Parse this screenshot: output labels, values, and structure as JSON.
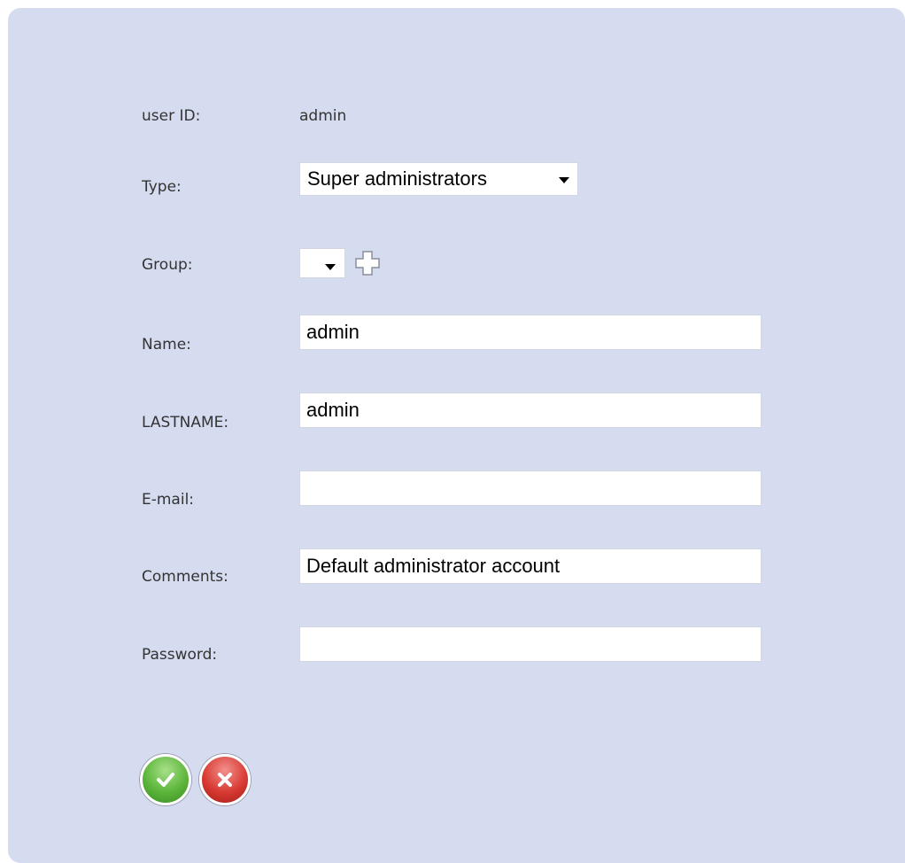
{
  "form": {
    "user_id": {
      "label": "user ID:",
      "value": "admin"
    },
    "type": {
      "label": "Type:",
      "selected": "Super administrators"
    },
    "group": {
      "label": "Group:",
      "selected": ""
    },
    "name": {
      "label": "Name:",
      "value": "admin"
    },
    "lastname": {
      "label": "LASTNAME:",
      "value": "admin"
    },
    "email": {
      "label": "E-mail:",
      "value": ""
    },
    "comments": {
      "label": "Comments:",
      "value": "Default administrator account"
    },
    "password": {
      "label": "Password:",
      "value": ""
    }
  },
  "icons": {
    "add_group": "plus-icon",
    "confirm": "checkmark-icon",
    "cancel": "x-icon",
    "dropdown": "chevron-down-icon"
  },
  "colors": {
    "panel_background": "#d6dcf0",
    "confirm_green": "#5cb53a",
    "cancel_red": "#d83a33"
  }
}
